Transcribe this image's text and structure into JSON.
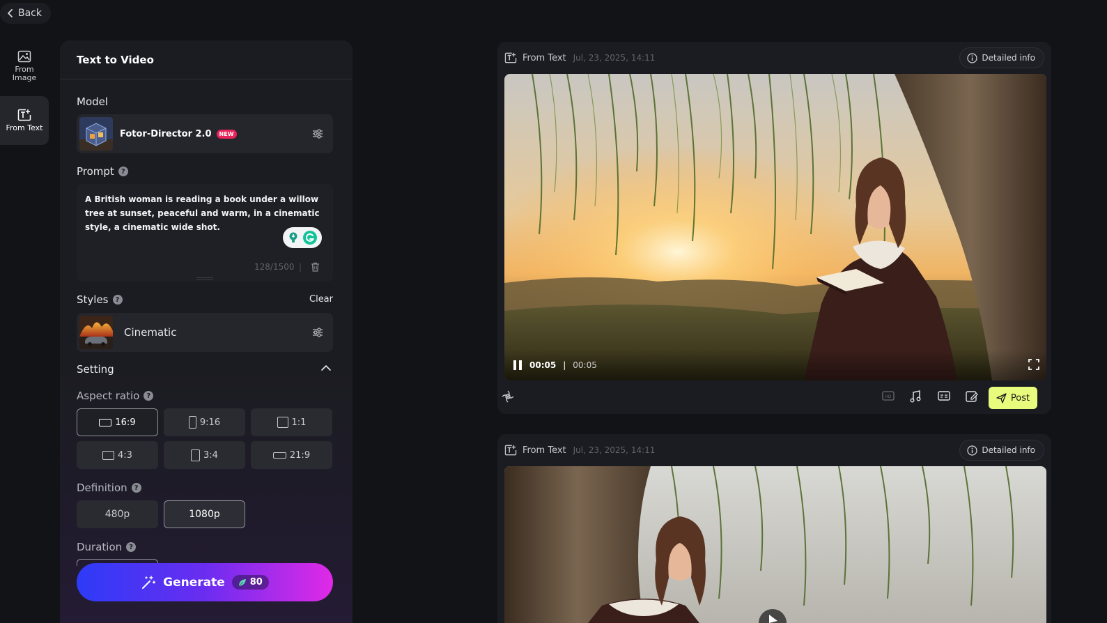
{
  "back": {
    "label": "Back"
  },
  "rail": {
    "items": [
      {
        "label": "From Image",
        "icon": "image-icon",
        "active": false
      },
      {
        "label": "From Text",
        "icon": "text-icon",
        "active": true
      }
    ]
  },
  "panel": {
    "title": "Text to Video",
    "model": {
      "label": "Model",
      "name": "Fotor-Director 2.0",
      "badge": "NEW"
    },
    "prompt": {
      "label": "Prompt",
      "text": "A British woman is reading a book under a willow tree at sunset, peaceful and warm, in a cinematic style, a cinematic wide shot.",
      "counter": "128/1500"
    },
    "styles": {
      "label": "Styles",
      "clear": "Clear",
      "selected": "Cinematic"
    },
    "setting": {
      "label": "Setting",
      "aspect_ratio": {
        "label": "Aspect ratio",
        "options": [
          "16:9",
          "9:16",
          "1:1",
          "4:3",
          "3:4",
          "21:9"
        ],
        "selected": "16:9"
      },
      "definition": {
        "label": "Definition",
        "options": [
          "480p",
          "1080p"
        ],
        "selected": "1080p"
      },
      "duration": {
        "label": "Duration"
      }
    },
    "generate": {
      "label": "Generate",
      "credits": "80"
    }
  },
  "results": [
    {
      "type": "From Text",
      "date": "Jul, 23, 2025, 14:11",
      "detail_label": "Detailed info",
      "player": {
        "current": "00:05",
        "separator": "|",
        "total": "00:05",
        "state": "playing"
      },
      "toolbar": {
        "post_label": "Post"
      }
    },
    {
      "type": "From Text",
      "date": "Jul, 23, 2025, 14:11",
      "detail_label": "Detailed info"
    }
  ],
  "colors": {
    "accent_post": "#e9fb7c",
    "badge_new": "#e8245b",
    "generate_from": "#2d3bf7",
    "generate_to": "#e02ae6"
  }
}
